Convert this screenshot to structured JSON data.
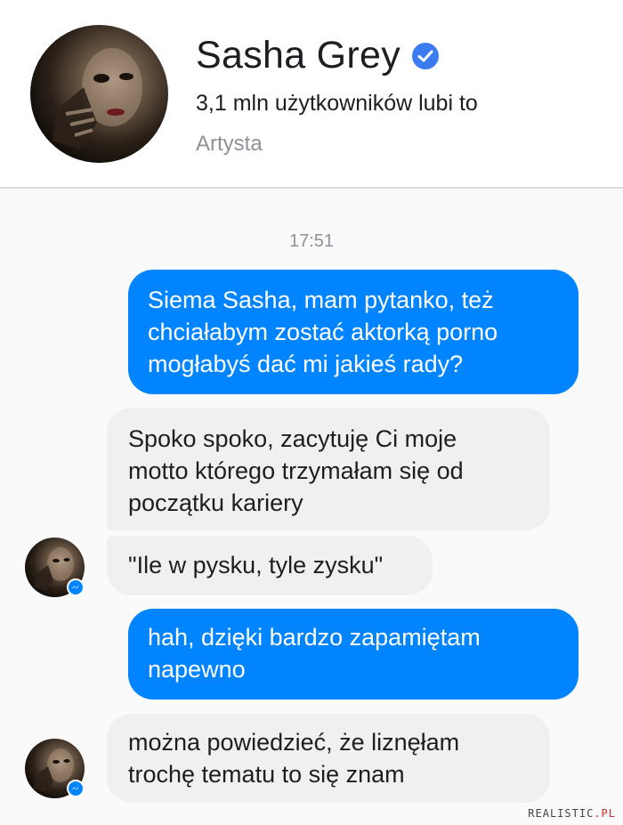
{
  "profile": {
    "name": "Sasha Grey",
    "likes": "3,1 mln użytkowników lubi to",
    "category": "Artysta",
    "verified": true,
    "avatar_icon": "profile-photo"
  },
  "conversation": {
    "timestamp": "17:51",
    "messages": [
      {
        "side": "outgoing",
        "text": "Siema Sasha, mam pytanko, też\nchciałabym zostać aktorką porno\nmogłabyś dać mi jakieś rady?"
      },
      {
        "side": "incoming",
        "text": "Spoko spoko, zacytuję Ci moje\nmotto którego trzymałam się od\npoczątku kariery"
      },
      {
        "side": "incoming",
        "text": "\"Ile w pysku, tyle zysku\""
      },
      {
        "side": "outgoing",
        "text": "hah, dzięki bardzo zapamiętam\nnapewno"
      },
      {
        "side": "incoming",
        "text": "można powiedzieć, że liznęłam\ntrochę tematu to się znam"
      }
    ]
  },
  "watermark": {
    "main": "REALISTIC",
    "suffix": ".PL"
  },
  "colors": {
    "outgoing_bubble": "#0084ff",
    "incoming_bubble": "#f0f0f0",
    "verified_badge": "#3b7cf0"
  }
}
